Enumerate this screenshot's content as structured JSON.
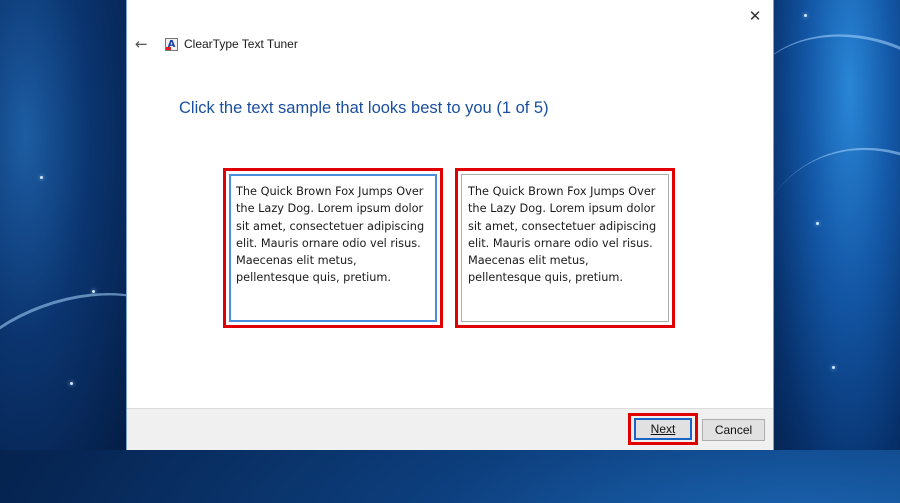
{
  "window": {
    "title": "ClearType Text Tuner",
    "close_glyph": "✕",
    "back_glyph": "←",
    "icon_letter": "A"
  },
  "main": {
    "heading": "Click the text sample that looks best to you (1 of 5)",
    "samples": [
      {
        "text": "The Quick Brown Fox Jumps Over the Lazy Dog. Lorem ipsum dolor sit amet, consectetuer adipiscing elit. Mauris ornare odio vel risus. Maecenas elit metus, pellentesque quis, pretium.",
        "selected": true
      },
      {
        "text": "The Quick Brown Fox Jumps Over the Lazy Dog. Lorem ipsum dolor sit amet, consectetuer adipiscing elit. Mauris ornare odio vel risus. Maecenas elit metus, pellentesque quis, pretium.",
        "selected": false
      }
    ]
  },
  "footer": {
    "next_label": "Next",
    "cancel_label": "Cancel"
  },
  "colors": {
    "highlight": "#e00000",
    "heading": "#1a4f9e",
    "selected_border": "#4a8fdb"
  }
}
